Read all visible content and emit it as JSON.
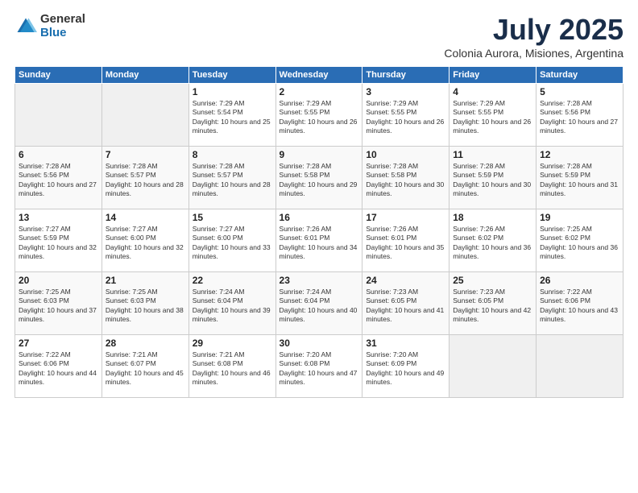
{
  "logo": {
    "general": "General",
    "blue": "Blue"
  },
  "title": "July 2025",
  "location": "Colonia Aurora, Misiones, Argentina",
  "days_of_week": [
    "Sunday",
    "Monday",
    "Tuesday",
    "Wednesday",
    "Thursday",
    "Friday",
    "Saturday"
  ],
  "weeks": [
    [
      {
        "day": "",
        "empty": true
      },
      {
        "day": "",
        "empty": true
      },
      {
        "day": "1",
        "sunrise": "Sunrise: 7:29 AM",
        "sunset": "Sunset: 5:54 PM",
        "daylight": "Daylight: 10 hours and 25 minutes."
      },
      {
        "day": "2",
        "sunrise": "Sunrise: 7:29 AM",
        "sunset": "Sunset: 5:55 PM",
        "daylight": "Daylight: 10 hours and 26 minutes."
      },
      {
        "day": "3",
        "sunrise": "Sunrise: 7:29 AM",
        "sunset": "Sunset: 5:55 PM",
        "daylight": "Daylight: 10 hours and 26 minutes."
      },
      {
        "day": "4",
        "sunrise": "Sunrise: 7:29 AM",
        "sunset": "Sunset: 5:55 PM",
        "daylight": "Daylight: 10 hours and 26 minutes."
      },
      {
        "day": "5",
        "sunrise": "Sunrise: 7:28 AM",
        "sunset": "Sunset: 5:56 PM",
        "daylight": "Daylight: 10 hours and 27 minutes."
      }
    ],
    [
      {
        "day": "6",
        "sunrise": "Sunrise: 7:28 AM",
        "sunset": "Sunset: 5:56 PM",
        "daylight": "Daylight: 10 hours and 27 minutes."
      },
      {
        "day": "7",
        "sunrise": "Sunrise: 7:28 AM",
        "sunset": "Sunset: 5:57 PM",
        "daylight": "Daylight: 10 hours and 28 minutes."
      },
      {
        "day": "8",
        "sunrise": "Sunrise: 7:28 AM",
        "sunset": "Sunset: 5:57 PM",
        "daylight": "Daylight: 10 hours and 28 minutes."
      },
      {
        "day": "9",
        "sunrise": "Sunrise: 7:28 AM",
        "sunset": "Sunset: 5:58 PM",
        "daylight": "Daylight: 10 hours and 29 minutes."
      },
      {
        "day": "10",
        "sunrise": "Sunrise: 7:28 AM",
        "sunset": "Sunset: 5:58 PM",
        "daylight": "Daylight: 10 hours and 30 minutes."
      },
      {
        "day": "11",
        "sunrise": "Sunrise: 7:28 AM",
        "sunset": "Sunset: 5:59 PM",
        "daylight": "Daylight: 10 hours and 30 minutes."
      },
      {
        "day": "12",
        "sunrise": "Sunrise: 7:28 AM",
        "sunset": "Sunset: 5:59 PM",
        "daylight": "Daylight: 10 hours and 31 minutes."
      }
    ],
    [
      {
        "day": "13",
        "sunrise": "Sunrise: 7:27 AM",
        "sunset": "Sunset: 5:59 PM",
        "daylight": "Daylight: 10 hours and 32 minutes."
      },
      {
        "day": "14",
        "sunrise": "Sunrise: 7:27 AM",
        "sunset": "Sunset: 6:00 PM",
        "daylight": "Daylight: 10 hours and 32 minutes."
      },
      {
        "day": "15",
        "sunrise": "Sunrise: 7:27 AM",
        "sunset": "Sunset: 6:00 PM",
        "daylight": "Daylight: 10 hours and 33 minutes."
      },
      {
        "day": "16",
        "sunrise": "Sunrise: 7:26 AM",
        "sunset": "Sunset: 6:01 PM",
        "daylight": "Daylight: 10 hours and 34 minutes."
      },
      {
        "day": "17",
        "sunrise": "Sunrise: 7:26 AM",
        "sunset": "Sunset: 6:01 PM",
        "daylight": "Daylight: 10 hours and 35 minutes."
      },
      {
        "day": "18",
        "sunrise": "Sunrise: 7:26 AM",
        "sunset": "Sunset: 6:02 PM",
        "daylight": "Daylight: 10 hours and 36 minutes."
      },
      {
        "day": "19",
        "sunrise": "Sunrise: 7:25 AM",
        "sunset": "Sunset: 6:02 PM",
        "daylight": "Daylight: 10 hours and 36 minutes."
      }
    ],
    [
      {
        "day": "20",
        "sunrise": "Sunrise: 7:25 AM",
        "sunset": "Sunset: 6:03 PM",
        "daylight": "Daylight: 10 hours and 37 minutes."
      },
      {
        "day": "21",
        "sunrise": "Sunrise: 7:25 AM",
        "sunset": "Sunset: 6:03 PM",
        "daylight": "Daylight: 10 hours and 38 minutes."
      },
      {
        "day": "22",
        "sunrise": "Sunrise: 7:24 AM",
        "sunset": "Sunset: 6:04 PM",
        "daylight": "Daylight: 10 hours and 39 minutes."
      },
      {
        "day": "23",
        "sunrise": "Sunrise: 7:24 AM",
        "sunset": "Sunset: 6:04 PM",
        "daylight": "Daylight: 10 hours and 40 minutes."
      },
      {
        "day": "24",
        "sunrise": "Sunrise: 7:23 AM",
        "sunset": "Sunset: 6:05 PM",
        "daylight": "Daylight: 10 hours and 41 minutes."
      },
      {
        "day": "25",
        "sunrise": "Sunrise: 7:23 AM",
        "sunset": "Sunset: 6:05 PM",
        "daylight": "Daylight: 10 hours and 42 minutes."
      },
      {
        "day": "26",
        "sunrise": "Sunrise: 7:22 AM",
        "sunset": "Sunset: 6:06 PM",
        "daylight": "Daylight: 10 hours and 43 minutes."
      }
    ],
    [
      {
        "day": "27",
        "sunrise": "Sunrise: 7:22 AM",
        "sunset": "Sunset: 6:06 PM",
        "daylight": "Daylight: 10 hours and 44 minutes."
      },
      {
        "day": "28",
        "sunrise": "Sunrise: 7:21 AM",
        "sunset": "Sunset: 6:07 PM",
        "daylight": "Daylight: 10 hours and 45 minutes."
      },
      {
        "day": "29",
        "sunrise": "Sunrise: 7:21 AM",
        "sunset": "Sunset: 6:08 PM",
        "daylight": "Daylight: 10 hours and 46 minutes."
      },
      {
        "day": "30",
        "sunrise": "Sunrise: 7:20 AM",
        "sunset": "Sunset: 6:08 PM",
        "daylight": "Daylight: 10 hours and 47 minutes."
      },
      {
        "day": "31",
        "sunrise": "Sunrise: 7:20 AM",
        "sunset": "Sunset: 6:09 PM",
        "daylight": "Daylight: 10 hours and 49 minutes."
      },
      {
        "day": "",
        "empty": true
      },
      {
        "day": "",
        "empty": true
      }
    ]
  ]
}
